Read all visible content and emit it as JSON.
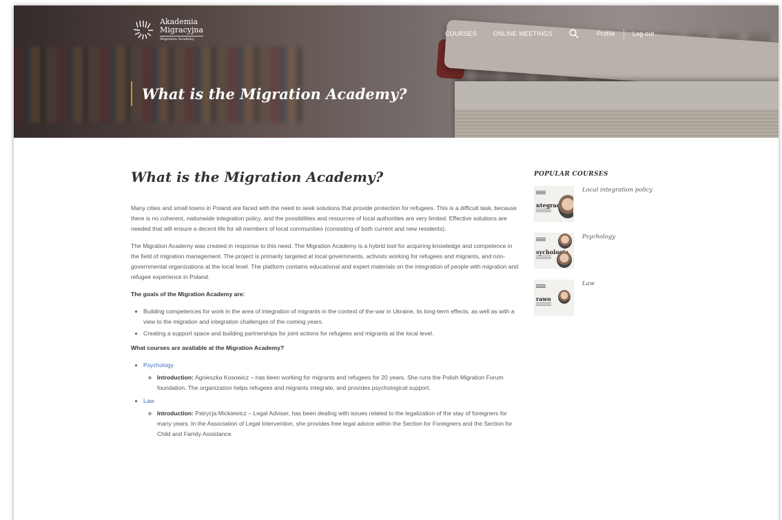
{
  "header": {
    "logo": {
      "line1": "Akademia",
      "line2": "Migracyjna",
      "line3": "Migration Academy"
    },
    "nav": {
      "courses": "COURSES",
      "online_meetings": "ONLINE MEETINGS",
      "profile": "Profile",
      "logout": "Log out"
    },
    "hero_title": "What is the Migration Academy?"
  },
  "main": {
    "title": "What is the Migration Academy?",
    "paragraphs": [
      "Many cities and small towns in Poland are faced with the need to seek solutions that provide protection for refugees. This is a difficult task, because there is no coherent, nationwide integration policy, and the possibilities and resources of local authorities are very limited. Effective solutions are needed that will ensure a decent life for all members of local communities (consisting of both current and new residents).",
      "The Migration Academy was created in response to this need. The Migration Academy is a hybrid tool for acquiring knowledge and competence in the field of migration management. The project is primarily targeted at local governments, activists working for refugees and migrants, and non-governmental organizations at the local level. The platform contains educational and expert materials on the integration of people with migration and refugee experience in Poland."
    ],
    "goals_heading": "The goals of the Migration Academy are:",
    "goals": [
      "Building competences for work in the area of integration of migrants in the context of the war in Ukraine, its long-term effects, as well as with a view to the migration and integration challenges of the coming years.",
      "Creating a support space and building partnerships for joint actions for refugees and migrants at the local level."
    ],
    "courses_heading": "What courses are available at the Migration Academy?",
    "courses": [
      {
        "name": "Psychology",
        "intro_label": "Introduction:",
        "intro_text": " Agnieszka Kosowicz – has been working for migrants and refugees for 20 years. She runs the Polish Migration Forum foundation. The organization helps refugees and migrants integrate, and provides psychological support."
      },
      {
        "name": "Law",
        "intro_label": "Introduction:",
        "intro_text": "  Patrycja Mickiewicz – Legal Adviser, has been dealing with issues related to the legalization of the stay of foreigners for many years. In the Association of Legal Intervention, she provides free legal advice within the Section for Foreigners and the Section for Child and Family Assistance."
      }
    ]
  },
  "sidebar": {
    "title": "POPULAR COURSES",
    "items": [
      {
        "label": "Local integration policy",
        "thumb_word": "ntegracja"
      },
      {
        "label": "Psychology",
        "thumb_word": "sychologia"
      },
      {
        "label": "Law",
        "thumb_word": "rawo"
      }
    ]
  },
  "colors": {
    "accent": "#e08a2a",
    "link": "#3b6fb5"
  }
}
